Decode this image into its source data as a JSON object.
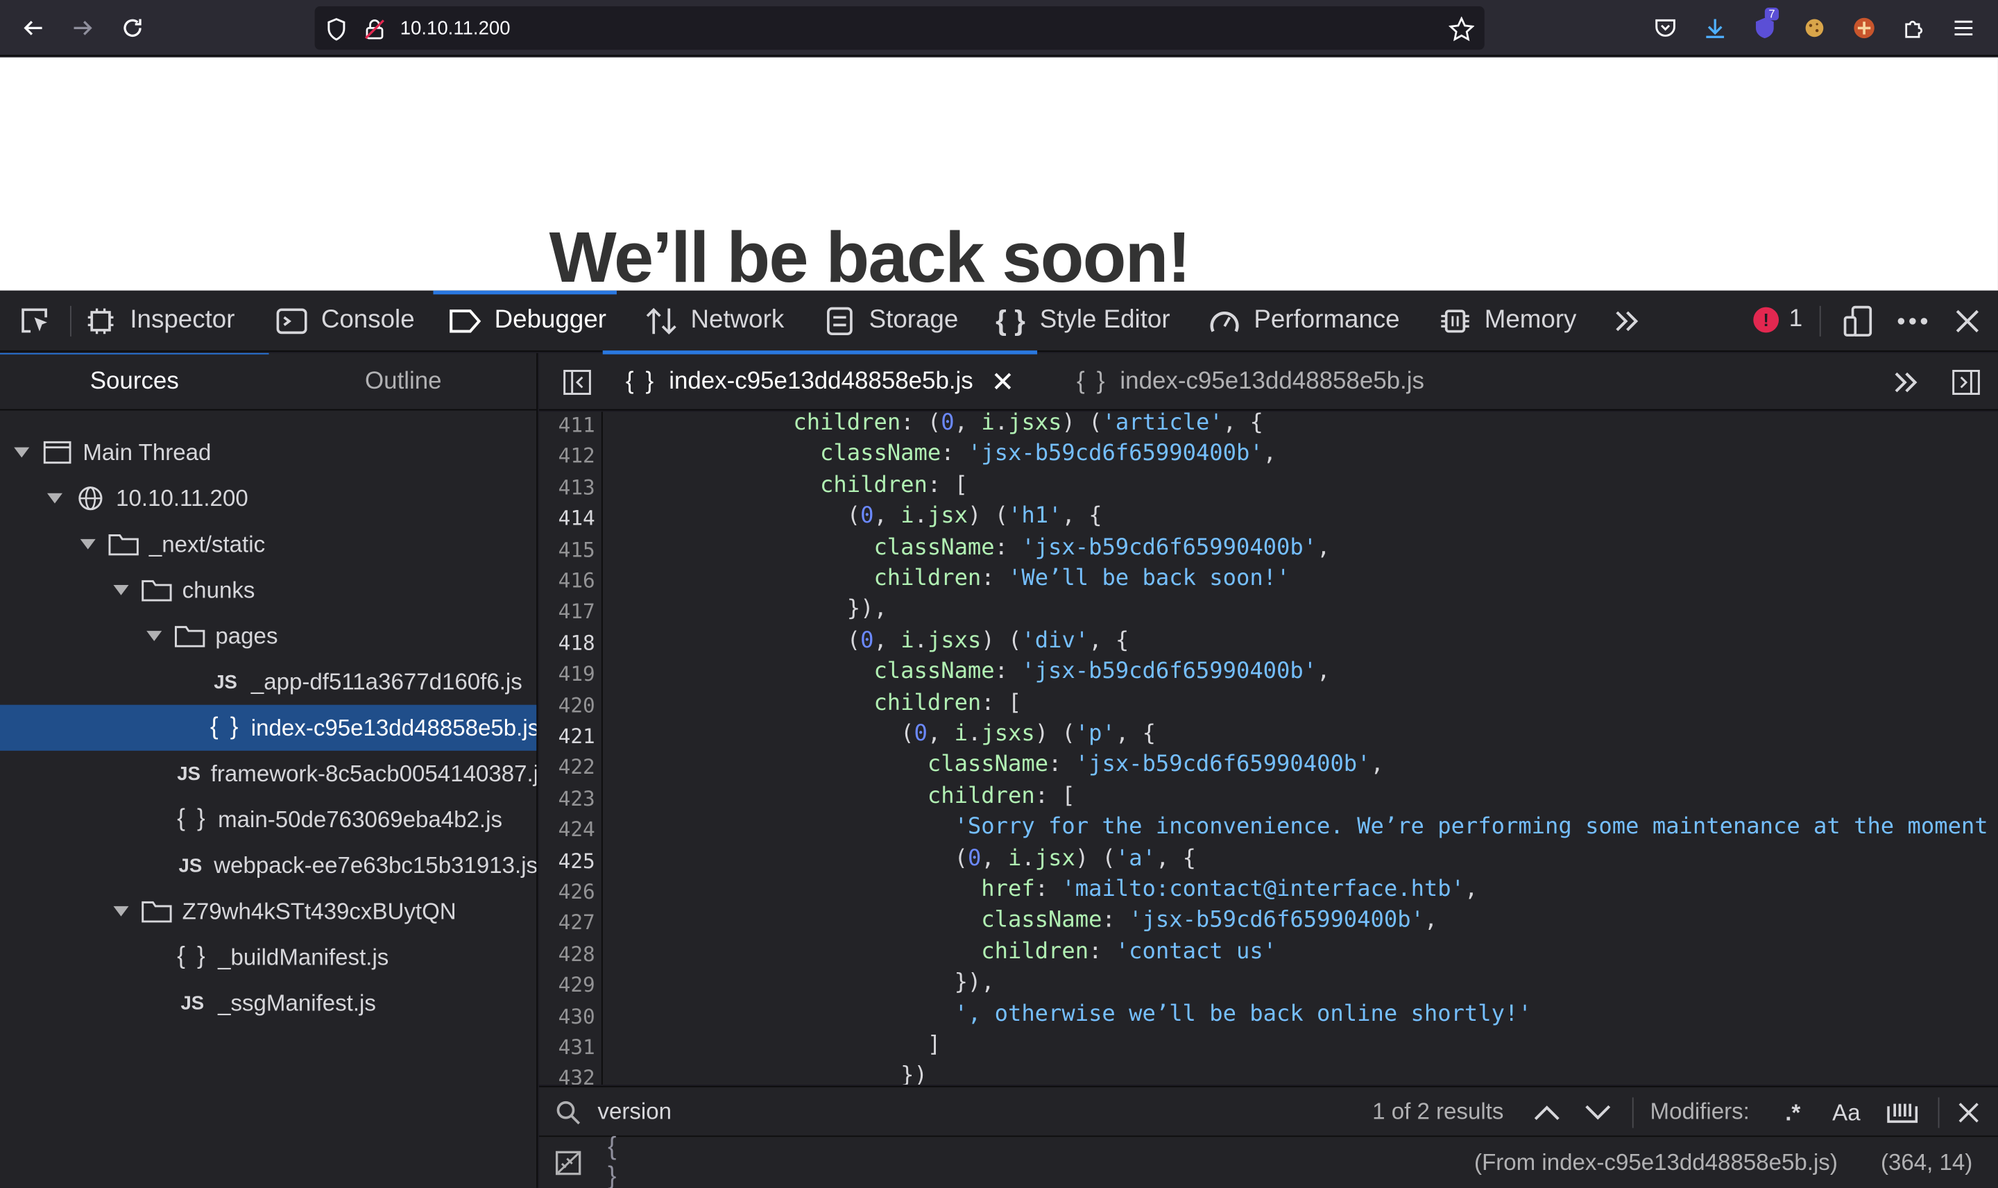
{
  "browser": {
    "url": "10.10.11.200",
    "extension_badge": "7"
  },
  "page": {
    "heading": "We’ll be back soon!"
  },
  "devtools": {
    "tabs": [
      {
        "label": "Inspector"
      },
      {
        "label": "Console"
      },
      {
        "label": "Debugger"
      },
      {
        "label": "Network"
      },
      {
        "label": "Storage"
      },
      {
        "label": "Style Editor"
      },
      {
        "label": "Performance"
      },
      {
        "label": "Memory"
      }
    ],
    "error_count": "1",
    "active_tab": "Debugger"
  },
  "sources": {
    "subtabs": [
      "Sources",
      "Outline"
    ],
    "tree": [
      {
        "label": "Main Thread",
        "type": "thread"
      },
      {
        "label": "10.10.11.200",
        "type": "domain"
      },
      {
        "label": "_next/static",
        "type": "folder"
      },
      {
        "label": "chunks",
        "type": "folder"
      },
      {
        "label": "pages",
        "type": "folder"
      },
      {
        "label": "_app-df511a3677d160f6.js",
        "type": "js"
      },
      {
        "label": "index-c95e13dd48858e5b.js",
        "type": "pretty",
        "selected": true
      },
      {
        "label": "framework-8c5acb0054140387.js",
        "type": "js"
      },
      {
        "label": "main-50de763069eba4b2.js",
        "type": "pretty"
      },
      {
        "label": "webpack-ee7e63bc15b31913.js",
        "type": "js"
      },
      {
        "label": "Z79wh4kSTt439cxBUytQN",
        "type": "folder"
      },
      {
        "label": "_buildManifest.js",
        "type": "pretty"
      },
      {
        "label": "_ssgManifest.js",
        "type": "js"
      }
    ]
  },
  "editor": {
    "tabs": [
      {
        "label": "index-c95e13dd48858e5b.js",
        "active": true
      },
      {
        "label": "index-c95e13dd48858e5b.js",
        "active": false
      }
    ],
    "lines": [
      {
        "n": "411",
        "bp": false
      },
      {
        "n": "412",
        "bp": false
      },
      {
        "n": "413",
        "bp": false
      },
      {
        "n": "414",
        "bp": true
      },
      {
        "n": "415",
        "bp": false
      },
      {
        "n": "416",
        "bp": false
      },
      {
        "n": "417",
        "bp": false
      },
      {
        "n": "418",
        "bp": true
      },
      {
        "n": "419",
        "bp": false
      },
      {
        "n": "420",
        "bp": false
      },
      {
        "n": "421",
        "bp": true
      },
      {
        "n": "422",
        "bp": false
      },
      {
        "n": "423",
        "bp": false
      },
      {
        "n": "424",
        "bp": false
      },
      {
        "n": "425",
        "bp": true
      },
      {
        "n": "426",
        "bp": false
      },
      {
        "n": "427",
        "bp": false
      },
      {
        "n": "428",
        "bp": false
      },
      {
        "n": "429",
        "bp": false
      },
      {
        "n": "430",
        "bp": false
      },
      {
        "n": "431",
        "bp": false
      },
      {
        "n": "432",
        "bp": false
      }
    ],
    "code": [
      [
        {
          "t": "              "
        },
        {
          "t": "children",
          "c": "k"
        },
        {
          "t": ": ("
        },
        {
          "t": "0",
          "c": "n"
        },
        {
          "t": ", "
        },
        {
          "t": "i",
          "c": "k"
        },
        {
          "t": "."
        },
        {
          "t": "jsxs",
          "c": "k"
        },
        {
          "t": ") ("
        },
        {
          "t": "'article'",
          "c": "s"
        },
        {
          "t": ", {"
        }
      ],
      [
        {
          "t": "                "
        },
        {
          "t": "className",
          "c": "k"
        },
        {
          "t": ": "
        },
        {
          "t": "'jsx-b59cd6f65990400b'",
          "c": "s"
        },
        {
          "t": ","
        }
      ],
      [
        {
          "t": "                "
        },
        {
          "t": "children",
          "c": "k"
        },
        {
          "t": ": ["
        }
      ],
      [
        {
          "t": "                  ("
        },
        {
          "t": "0",
          "c": "n"
        },
        {
          "t": ", "
        },
        {
          "t": "i",
          "c": "k"
        },
        {
          "t": "."
        },
        {
          "t": "jsx",
          "c": "k"
        },
        {
          "t": ") ("
        },
        {
          "t": "'h1'",
          "c": "s"
        },
        {
          "t": ", {"
        }
      ],
      [
        {
          "t": "                    "
        },
        {
          "t": "className",
          "c": "k"
        },
        {
          "t": ": "
        },
        {
          "t": "'jsx-b59cd6f65990400b'",
          "c": "s"
        },
        {
          "t": ","
        }
      ],
      [
        {
          "t": "                    "
        },
        {
          "t": "children",
          "c": "k"
        },
        {
          "t": ": "
        },
        {
          "t": "'We’ll be back soon!'",
          "c": "s"
        }
      ],
      [
        {
          "t": "                  }),"
        }
      ],
      [
        {
          "t": "                  ("
        },
        {
          "t": "0",
          "c": "n"
        },
        {
          "t": ", "
        },
        {
          "t": "i",
          "c": "k"
        },
        {
          "t": "."
        },
        {
          "t": "jsxs",
          "c": "k"
        },
        {
          "t": ") ("
        },
        {
          "t": "'div'",
          "c": "s"
        },
        {
          "t": ", {"
        }
      ],
      [
        {
          "t": "                    "
        },
        {
          "t": "className",
          "c": "k"
        },
        {
          "t": ": "
        },
        {
          "t": "'jsx-b59cd6f65990400b'",
          "c": "s"
        },
        {
          "t": ","
        }
      ],
      [
        {
          "t": "                    "
        },
        {
          "t": "children",
          "c": "k"
        },
        {
          "t": ": ["
        }
      ],
      [
        {
          "t": "                      ("
        },
        {
          "t": "0",
          "c": "n"
        },
        {
          "t": ", "
        },
        {
          "t": "i",
          "c": "k"
        },
        {
          "t": "."
        },
        {
          "t": "jsxs",
          "c": "k"
        },
        {
          "t": ") ("
        },
        {
          "t": "'p'",
          "c": "s"
        },
        {
          "t": ", {"
        }
      ],
      [
        {
          "t": "                        "
        },
        {
          "t": "className",
          "c": "k"
        },
        {
          "t": ": "
        },
        {
          "t": "'jsx-b59cd6f65990400b'",
          "c": "s"
        },
        {
          "t": ","
        }
      ],
      [
        {
          "t": "                        "
        },
        {
          "t": "children",
          "c": "k"
        },
        {
          "t": ": ["
        }
      ],
      [
        {
          "t": "                          "
        },
        {
          "t": "'Sorry for the inconvenience. We’re performing some maintenance at the moment",
          "c": "s"
        }
      ],
      [
        {
          "t": "                          ("
        },
        {
          "t": "0",
          "c": "n"
        },
        {
          "t": ", "
        },
        {
          "t": "i",
          "c": "k"
        },
        {
          "t": "."
        },
        {
          "t": "jsx",
          "c": "k"
        },
        {
          "t": ") ("
        },
        {
          "t": "'a'",
          "c": "s"
        },
        {
          "t": ", {"
        }
      ],
      [
        {
          "t": "                            "
        },
        {
          "t": "href",
          "c": "k"
        },
        {
          "t": ": "
        },
        {
          "t": "'mailto:contact@interface.htb'",
          "c": "s"
        },
        {
          "t": ","
        }
      ],
      [
        {
          "t": "                            "
        },
        {
          "t": "className",
          "c": "k"
        },
        {
          "t": ": "
        },
        {
          "t": "'jsx-b59cd6f65990400b'",
          "c": "s"
        },
        {
          "t": ","
        }
      ],
      [
        {
          "t": "                            "
        },
        {
          "t": "children",
          "c": "k"
        },
        {
          "t": ": "
        },
        {
          "t": "'contact us'",
          "c": "s"
        }
      ],
      [
        {
          "t": "                          }),"
        }
      ],
      [
        {
          "t": "                          "
        },
        {
          "t": "', otherwise we’ll be back online shortly!'",
          "c": "s"
        }
      ],
      [
        {
          "t": "                        ]"
        }
      ],
      [
        {
          "t": "                      })"
        }
      ]
    ]
  },
  "search": {
    "query": "version",
    "results": "1 of 2 results",
    "modifiers_label": "Modifiers:",
    "regex": ".*",
    "case": "Aa"
  },
  "footer": {
    "source": "(From index-c95e13dd48858e5b.js)",
    "position": "(364, 14)"
  },
  "colors": {
    "accent": "#2a78e0",
    "selection": "#204e8a",
    "code_keyword": "#b1f0b3",
    "code_string": "#75bfff",
    "error": "#e22850"
  }
}
